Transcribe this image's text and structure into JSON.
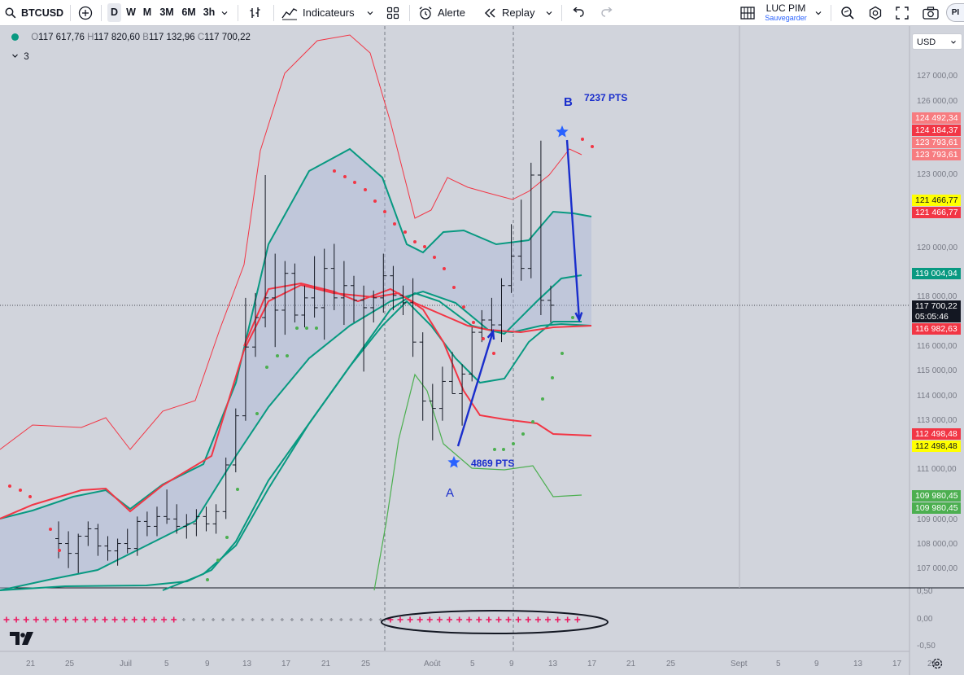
{
  "toolbar": {
    "symbol": "BTCUSD",
    "timeframes": [
      "D",
      "W",
      "M",
      "3M",
      "6M",
      "3h"
    ],
    "active_timeframe": "D",
    "indicators_label": "Indicateurs",
    "alert_label": "Alerte",
    "replay_label": "Replay",
    "user_name": "LUC PIM",
    "save_label": "Sauvegarder",
    "profile_initial": "PI"
  },
  "legend": {
    "open_key": "O",
    "open": "117 617,76",
    "high_key": "H",
    "high": "117 820,60",
    "low_key": "B",
    "low": "117 132,96",
    "close_key": "C",
    "close": "117 700,22",
    "indicator_count": "3"
  },
  "currency": "USD",
  "price_badges": [
    {
      "label": "124 492,34",
      "bg": "#f77c80",
      "fg": "#ffffff"
    },
    {
      "label": "124 184,37",
      "bg": "#f23645",
      "fg": "#ffffff"
    },
    {
      "label": "123 793,61",
      "bg": "#f77c80",
      "fg": "#ffffff"
    },
    {
      "label": "123 793,61",
      "bg": "#f77c80",
      "fg": "#ffffff"
    },
    {
      "label": "121 466,77",
      "bg": "#ffff00",
      "fg": "#131722"
    },
    {
      "label": "121 466,77",
      "bg": "#f23645",
      "fg": "#ffffff"
    },
    {
      "label": "119 004,94",
      "bg": "#089981",
      "fg": "#ffffff"
    },
    {
      "label": "117 700,22",
      "bg": "#131722",
      "fg": "#ffffff"
    },
    {
      "label": "05:05:46",
      "bg": "#131722",
      "fg": "#ffffff"
    },
    {
      "label": "116 982,63",
      "bg": "#f23645",
      "fg": "#ffffff"
    },
    {
      "label": "112 498,48",
      "bg": "#f23645",
      "fg": "#ffffff"
    },
    {
      "label": "112 498,48",
      "bg": "#ffff00",
      "fg": "#131722"
    },
    {
      "label": "109 980,45",
      "bg": "#4caf50",
      "fg": "#ffffff"
    },
    {
      "label": "109 980,45",
      "bg": "#4caf50",
      "fg": "#ffffff"
    }
  ],
  "price_scale": [
    "127 000,00",
    "126 000,00",
    "123 000,00",
    "120 000,00",
    "118 000,00",
    "116 000,00",
    "115 000,00",
    "114 000,00",
    "113 000,00",
    "111 000,00",
    "109 000,00",
    "108 000,00",
    "107 000,00"
  ],
  "osc_scale": [
    "0,50",
    "0,00",
    "-0,50"
  ],
  "time_axis": [
    "21",
    "25",
    "Juil",
    "5",
    "9",
    "13",
    "17",
    "21",
    "25",
    "Août",
    "5",
    "9",
    "13",
    "17",
    "21",
    "25",
    "Sept",
    "5",
    "9",
    "13",
    "17",
    "21"
  ],
  "annotations": {
    "b_label": "B",
    "b_pts": "7237 PTS",
    "a_label": "A",
    "a_pts": "4869 PTS"
  },
  "chart_data": {
    "type": "candlestick",
    "ylim": [
      106500,
      128500
    ],
    "candles": [
      {
        "o": 108200,
        "h": 108900,
        "l": 107400,
        "c": 108000
      },
      {
        "o": 108000,
        "h": 108500,
        "l": 107000,
        "c": 107600
      },
      {
        "o": 107600,
        "h": 108400,
        "l": 106800,
        "c": 108300
      },
      {
        "o": 108300,
        "h": 108900,
        "l": 107900,
        "c": 108600
      },
      {
        "o": 108600,
        "h": 108800,
        "l": 107500,
        "c": 107900
      },
      {
        "o": 107900,
        "h": 108300,
        "l": 107300,
        "c": 107700
      },
      {
        "o": 107700,
        "h": 108200,
        "l": 107100,
        "c": 108000
      },
      {
        "o": 108000,
        "h": 108600,
        "l": 107600,
        "c": 107800
      },
      {
        "o": 107800,
        "h": 109100,
        "l": 107500,
        "c": 108900
      },
      {
        "o": 108900,
        "h": 109300,
        "l": 108300,
        "c": 108700
      },
      {
        "o": 108700,
        "h": 109500,
        "l": 108300,
        "c": 109100
      },
      {
        "o": 109100,
        "h": 110200,
        "l": 108800,
        "c": 109000
      },
      {
        "o": 109000,
        "h": 109600,
        "l": 108400,
        "c": 108700
      },
      {
        "o": 108700,
        "h": 109200,
        "l": 108200,
        "c": 108800
      },
      {
        "o": 108800,
        "h": 109400,
        "l": 108300,
        "c": 109100
      },
      {
        "o": 109100,
        "h": 109500,
        "l": 108500,
        "c": 108800
      },
      {
        "o": 108800,
        "h": 109600,
        "l": 108400,
        "c": 109300
      },
      {
        "o": 109300,
        "h": 111500,
        "l": 109000,
        "c": 111200
      },
      {
        "o": 111200,
        "h": 113500,
        "l": 110900,
        "c": 113200
      },
      {
        "o": 113200,
        "h": 118000,
        "l": 113000,
        "c": 116000
      },
      {
        "o": 116000,
        "h": 118200,
        "l": 115600,
        "c": 117200
      },
      {
        "o": 117200,
        "h": 123000,
        "l": 116800,
        "c": 118000
      },
      {
        "o": 118000,
        "h": 119800,
        "l": 116000,
        "c": 117500
      },
      {
        "o": 117500,
        "h": 119500,
        "l": 116500,
        "c": 119000
      },
      {
        "o": 119000,
        "h": 119400,
        "l": 117000,
        "c": 117300
      },
      {
        "o": 117300,
        "h": 118500,
        "l": 116800,
        "c": 118000
      },
      {
        "o": 118000,
        "h": 119700,
        "l": 117200,
        "c": 117600
      },
      {
        "o": 117600,
        "h": 120000,
        "l": 116300,
        "c": 119200
      },
      {
        "o": 119200,
        "h": 120200,
        "l": 117500,
        "c": 118000
      },
      {
        "o": 118000,
        "h": 119500,
        "l": 116900,
        "c": 118500
      },
      {
        "o": 118500,
        "h": 118900,
        "l": 117000,
        "c": 117900
      },
      {
        "o": 117900,
        "h": 118500,
        "l": 115000,
        "c": 117600
      },
      {
        "o": 117600,
        "h": 118300,
        "l": 117000,
        "c": 118000
      },
      {
        "o": 118000,
        "h": 119800,
        "l": 117400,
        "c": 118900
      },
      {
        "o": 118900,
        "h": 119300,
        "l": 117500,
        "c": 118100
      },
      {
        "o": 118100,
        "h": 118500,
        "l": 117300,
        "c": 117800
      },
      {
        "o": 117800,
        "h": 118800,
        "l": 115600,
        "c": 116200
      },
      {
        "o": 116200,
        "h": 116600,
        "l": 113000,
        "c": 113800
      },
      {
        "o": 113800,
        "h": 114500,
        "l": 112200,
        "c": 113500
      },
      {
        "o": 113500,
        "h": 115200,
        "l": 113000,
        "c": 114600
      },
      {
        "o": 114600,
        "h": 115800,
        "l": 114100,
        "c": 114100
      },
      {
        "o": 114100,
        "h": 115300,
        "l": 112800,
        "c": 114900
      },
      {
        "o": 114900,
        "h": 116800,
        "l": 114600,
        "c": 116600
      },
      {
        "o": 116600,
        "h": 117500,
        "l": 116200,
        "c": 117100
      },
      {
        "o": 117100,
        "h": 118000,
        "l": 116600,
        "c": 116900
      },
      {
        "o": 116900,
        "h": 118800,
        "l": 116200,
        "c": 118500
      },
      {
        "o": 118500,
        "h": 121000,
        "l": 118200,
        "c": 119700
      },
      {
        "o": 119700,
        "h": 122000,
        "l": 118700,
        "c": 119200
      },
      {
        "o": 119200,
        "h": 123500,
        "l": 118800,
        "c": 123000
      },
      {
        "o": 123000,
        "h": 124400,
        "l": 117300,
        "c": 117900
      },
      {
        "o": 117900,
        "h": 118500,
        "l": 117000,
        "c": 117700
      }
    ]
  }
}
